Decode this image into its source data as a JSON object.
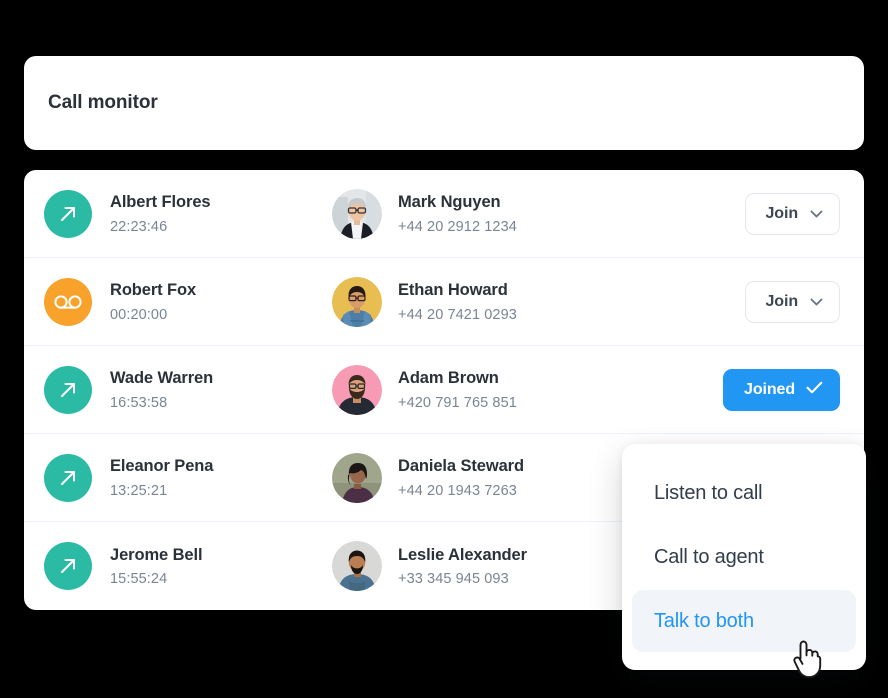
{
  "header": {
    "title": "Call monitor"
  },
  "calls": [
    {
      "direction_icon": "outgoing-call-icon",
      "caller_name": "Albert Flores",
      "duration": "22:23:46",
      "avatar": "avatar-mark-nguyen",
      "contact_name": "Mark Nguyen",
      "contact_phone": "+44 20 2912 1234",
      "action_label": "Join",
      "action_state": "join"
    },
    {
      "direction_icon": "voicemail-icon",
      "caller_name": "Robert Fox",
      "duration": "00:20:00",
      "avatar": "avatar-ethan-howard",
      "contact_name": "Ethan Howard",
      "contact_phone": "+44 20 7421 0293",
      "action_label": "Join",
      "action_state": "join"
    },
    {
      "direction_icon": "outgoing-call-icon",
      "caller_name": "Wade Warren",
      "duration": "16:53:58",
      "avatar": "avatar-adam-brown",
      "contact_name": "Adam Brown",
      "contact_phone": "+420 791 765 851",
      "action_label": "Joined",
      "action_state": "joined"
    },
    {
      "direction_icon": "outgoing-call-icon",
      "caller_name": "Eleanor Pena",
      "duration": "13:25:21",
      "avatar": "avatar-daniela-steward",
      "contact_name": "Daniela Steward",
      "contact_phone": "+44 20 1943 7263",
      "action_label": "",
      "action_state": "hidden"
    },
    {
      "direction_icon": "outgoing-call-icon",
      "caller_name": "Jerome Bell",
      "duration": "15:55:24",
      "avatar": "avatar-leslie-alexander",
      "contact_name": "Leslie Alexander",
      "contact_phone": "+33 345 945 093",
      "action_label": "",
      "action_state": "hidden"
    }
  ],
  "dropdown": {
    "items": [
      {
        "label": "Listen to call",
        "active": false
      },
      {
        "label": "Call to agent",
        "active": false
      },
      {
        "label": "Talk to both",
        "active": true
      }
    ]
  },
  "colors": {
    "outgoing": "#2bbba5",
    "voicemail": "#f9a22b",
    "joined": "#2196f3",
    "accent": "#2196f3",
    "background": "#000000",
    "card": "#ffffff",
    "divider": "#eef1fb",
    "text_primary": "#2b3138",
    "text_secondary": "#7b8494",
    "menu_active_bg": "#f1f4f9"
  }
}
